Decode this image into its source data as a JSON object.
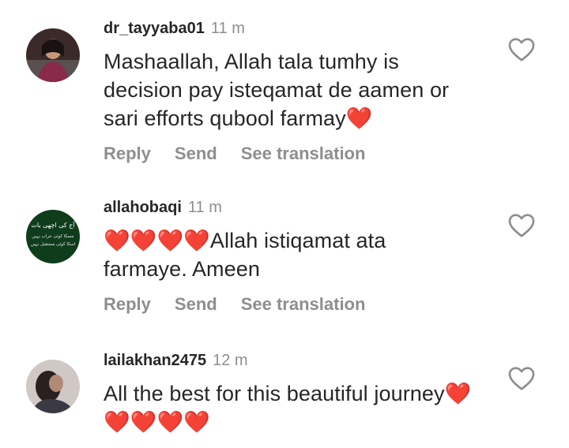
{
  "comments": [
    {
      "username": "dr_tayyaba01",
      "time": "11 m",
      "text": "Mashaallah, Allah tala tumhy is decision pay isteqamat de aamen or sari efforts qubool farmay❤️",
      "actions": {
        "reply": "Reply",
        "send": "Send",
        "translate": "See translation"
      }
    },
    {
      "username": "allahobaqi",
      "time": "11 m",
      "text": "❤️❤️❤️❤️Allah istiqamat ata farmaye. Ameen",
      "avatar_text": [
        "آج کی اچھی بات",
        "جسکا کوئی خراب نہیں",
        "اسکا کوئی مستقبل نہیں"
      ],
      "actions": {
        "reply": "Reply",
        "send": "Send",
        "translate": "See translation"
      }
    },
    {
      "username": "lailakhan2475",
      "time": "12 m",
      "text": "All the best for this beautiful journey❤️❤️❤️❤️❤️"
    }
  ],
  "colors": {
    "text": "#262626",
    "secondary": "#8e8e8e",
    "heart_emoji": "#e0245e",
    "avatar2_bg": "#0f3d1c"
  },
  "icons": {
    "like": "heart-outline-icon"
  }
}
